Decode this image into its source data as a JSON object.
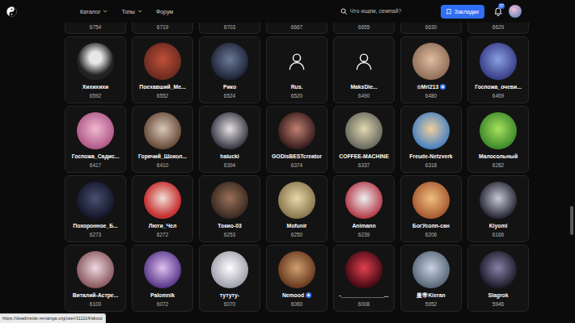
{
  "navbar": {
    "menu": [
      {
        "label": "Каталог",
        "dropdown": true
      },
      {
        "label": "Топы",
        "dropdown": true
      },
      {
        "label": "Форум",
        "dropdown": false
      }
    ],
    "search": {
      "placeholder": "Что ищем, семпай?"
    },
    "bookmarks_button": "Закладки",
    "notifications_badge": "37"
  },
  "partial_row": [
    "6754",
    "6719",
    "6703",
    "6667",
    "6655",
    "6630",
    "6629"
  ],
  "users": [
    {
      "name": "Хихихихи",
      "count": "6592",
      "kind": "photo",
      "verified": false
    },
    {
      "name": "Поехавший_Ме...",
      "count": "6552",
      "kind": "photo",
      "verified": false
    },
    {
      "name": "Рико",
      "count": "6524",
      "kind": "photo",
      "verified": false
    },
    {
      "name": "Rus.",
      "count": "6520",
      "kind": "default",
      "verified": false
    },
    {
      "name": "MaksDie...",
      "count": "6490",
      "kind": "default",
      "verified": false
    },
    {
      "name": "☆Mrl213",
      "count": "6480",
      "kind": "photo",
      "verified": true
    },
    {
      "name": "Госпожа_очеви...",
      "count": "6469",
      "kind": "photo",
      "verified": false
    },
    {
      "name": "Госпожа_Садис...",
      "count": "6417",
      "kind": "photo",
      "verified": false
    },
    {
      "name": "Горячий_Шокол...",
      "count": "6410",
      "kind": "photo",
      "verified": false
    },
    {
      "name": "haiucki",
      "count": "6394",
      "kind": "photo",
      "verified": false
    },
    {
      "name": "GODisBESTcreator",
      "count": "6374",
      "kind": "photo",
      "verified": false
    },
    {
      "name": "COFFEE-MACHINE",
      "count": "6337",
      "kind": "photo",
      "verified": false
    },
    {
      "name": "Freude-Netzverk",
      "count": "6318",
      "kind": "photo",
      "verified": false
    },
    {
      "name": "Малосольный",
      "count": "6282",
      "kind": "photo",
      "verified": false
    },
    {
      "name": "Похоронное_Б...",
      "count": "6273",
      "kind": "photo",
      "verified": false
    },
    {
      "name": "Люти_Чел",
      "count": "6272",
      "kind": "photo",
      "verified": false
    },
    {
      "name": "Токио-03",
      "count": "6253",
      "kind": "photo",
      "verified": false
    },
    {
      "name": "Mofunir",
      "count": "6250",
      "kind": "photo",
      "verified": false
    },
    {
      "name": "Animann",
      "count": "6239",
      "kind": "photo",
      "verified": false
    },
    {
      "name": "БогУсопп-сан",
      "count": "6206",
      "kind": "photo",
      "verified": false
    },
    {
      "name": "Kiyomi",
      "count": "6166",
      "kind": "photo",
      "verified": false
    },
    {
      "name": "Виталий-Астре...",
      "count": "6100",
      "kind": "photo",
      "verified": false
    },
    {
      "name": "Palomnik",
      "count": "6072",
      "kind": "photo",
      "verified": false
    },
    {
      "name": "тутуту-",
      "count": "6070",
      "kind": "photo",
      "verified": false
    },
    {
      "name": "Nemood",
      "count": "6060",
      "kind": "photo",
      "verified": true
    },
    {
      "name": "-______________...",
      "count": "6008",
      "kind": "photo",
      "verified": false
    },
    {
      "name": "皇帝Kieran",
      "count": "5952",
      "kind": "photo",
      "verified": false
    },
    {
      "name": "Slagrok",
      "count": "5946",
      "kind": "photo",
      "verified": false
    }
  ],
  "status_url": "https://deadinside.remanga.org/user/111114/about"
}
